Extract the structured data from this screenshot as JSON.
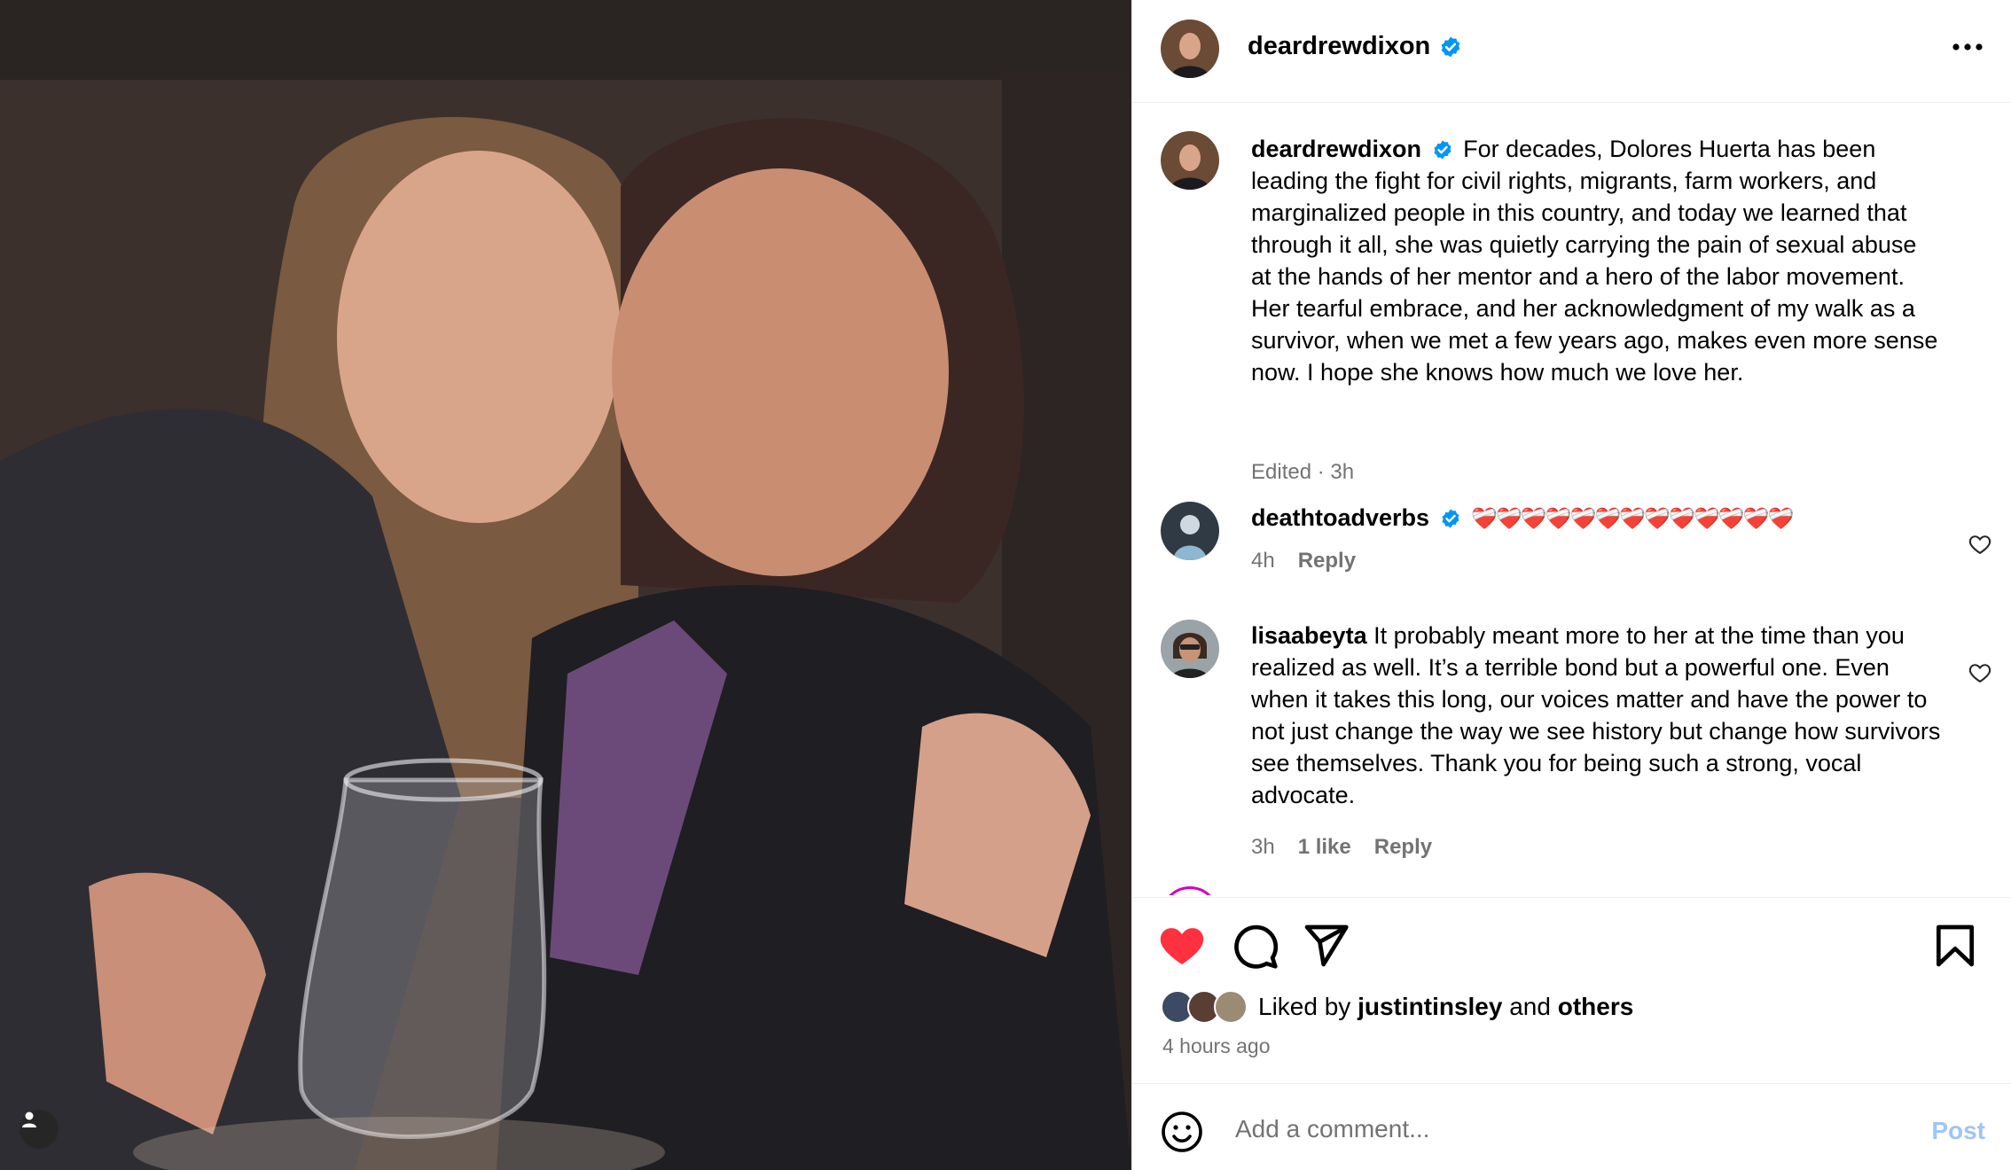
{
  "post": {
    "author": "deardrewdixon",
    "author_verified": true,
    "more_icon": "more-horizontal-icon"
  },
  "caption": {
    "username": "deardrewdixon",
    "text": "For decades, Dolores Huerta has been leading the fight for civil rights, migrants, farm workers, and marginalized people in this country, and today we learned that through it all, she was quietly carrying the pain of sexual abuse at the hands of her mentor and a hero of the labor movement. Her tearful embrace, and her acknowledgment of my walk as a survivor, when we met a few years ago, makes even more sense now. I hope she knows how much we love her.",
    "meta": "Edited · 3h"
  },
  "comments": [
    {
      "username": "deathtoadverbs",
      "verified": true,
      "text": "❤️‍🩹❤️‍🩹❤️‍🩹❤️‍🩹❤️‍🩹❤️‍🩹❤️‍🩹❤️‍🩹❤️‍🩹❤️‍🩹❤️‍🩹❤️‍🩹❤️‍🩹",
      "time": "4h",
      "likes": "",
      "reply": "Reply"
    },
    {
      "username": "lisaabeyta",
      "verified": false,
      "text": "It probably meant more to her at the time than you realized as well. It’s a terrible bond but a powerful one. Even when it takes this long, our voices matter and have the power to not just change the way we see history but change how survivors see themselves. Thank you for being such a strong, vocal advocate.",
      "time": "3h",
      "likes": "1 like",
      "reply": "Reply"
    }
  ],
  "actions": {
    "liked": true,
    "like_color": "#ff3040",
    "liked_by_prefix": "Liked by",
    "liked_by_user": "justintinsley",
    "liked_by_and": "and",
    "liked_by_others": "others",
    "time_ago": "4 hours ago"
  },
  "composer": {
    "placeholder": "Add a comment...",
    "post_label": "Post"
  },
  "colors": {
    "verified": "#0095f6",
    "secondary_text": "#737373",
    "post_disabled": "#a0c4f5"
  }
}
